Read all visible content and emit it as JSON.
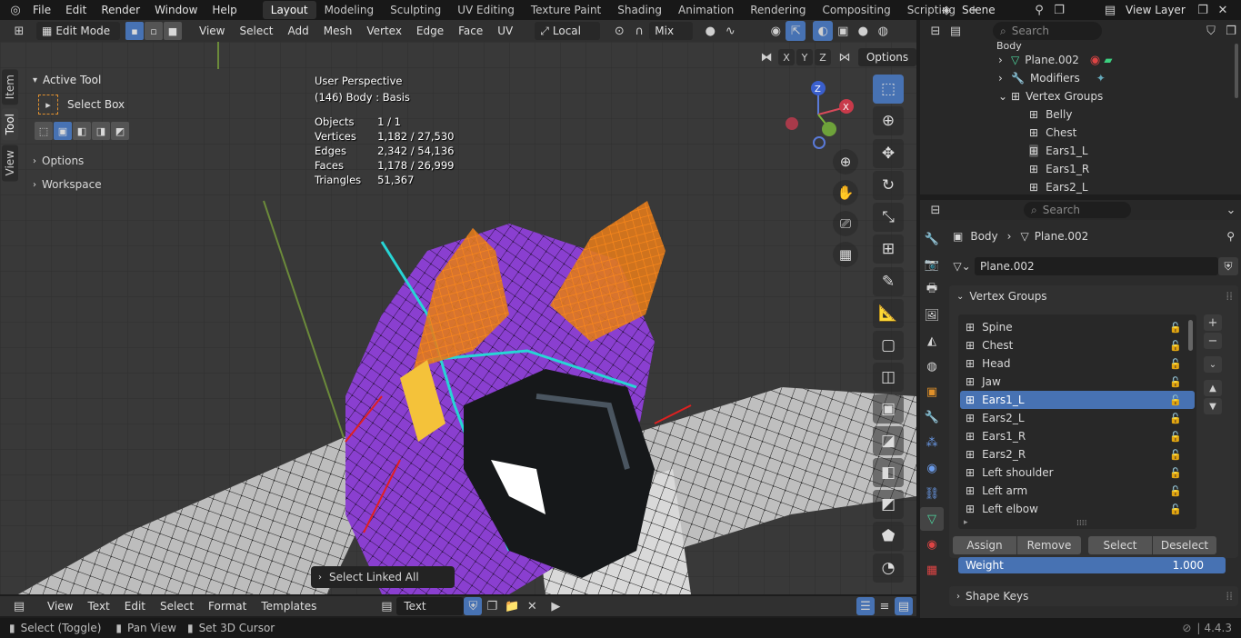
{
  "topbar": {
    "menus": [
      "File",
      "Edit",
      "Render",
      "Window",
      "Help"
    ],
    "workspaces": [
      "Layout",
      "Modeling",
      "Sculpting",
      "UV Editing",
      "Texture Paint",
      "Shading",
      "Animation",
      "Rendering",
      "Compositing",
      "Scripting"
    ],
    "active_workspace": "Layout",
    "scene": "Scene",
    "view_layer": "View Layer"
  },
  "viewport_header": {
    "mode": "Edit Mode",
    "menus": [
      "View",
      "Select",
      "Add",
      "Mesh",
      "Vertex",
      "Edge",
      "Face",
      "UV"
    ],
    "orientation": "Local",
    "snap": "Mix",
    "options": "Options",
    "axes": [
      "X",
      "Y",
      "Z"
    ]
  },
  "sidebar": {
    "tabs": [
      "Item",
      "Tool",
      "View"
    ],
    "active_tab": "Tool",
    "active_tool_title": "Active Tool",
    "active_tool": "Select Box",
    "options": "Options",
    "workspace": "Workspace"
  },
  "overlay": {
    "perspective": "User Perspective",
    "object": "(146) Body : Basis",
    "stats": [
      {
        "label": "Objects",
        "value": "1 / 1"
      },
      {
        "label": "Vertices",
        "value": "1,182 / 27,530"
      },
      {
        "label": "Edges",
        "value": "2,342 / 54,136"
      },
      {
        "label": "Faces",
        "value": "1,178 / 26,999"
      },
      {
        "label": "Triangles",
        "value": "51,367"
      }
    ],
    "last_op": "Select Linked All"
  },
  "outliner": {
    "search_placeholder": "Search",
    "items": [
      {
        "label": "Body",
        "indent": 0,
        "icon": "mesh-icon"
      },
      {
        "label": "Plane.002",
        "indent": 1,
        "icon": "mesh-data-icon"
      },
      {
        "label": "Modifiers",
        "indent": 1,
        "icon": "wrench-icon"
      },
      {
        "label": "Vertex Groups",
        "indent": 1,
        "icon": "vertex-group-icon"
      },
      {
        "label": "Belly",
        "indent": 2,
        "icon": "vertex-group-icon"
      },
      {
        "label": "Chest",
        "indent": 2,
        "icon": "vertex-group-icon"
      },
      {
        "label": "Ears1_L",
        "indent": 2,
        "icon": "vertex-group-icon"
      },
      {
        "label": "Ears1_R",
        "indent": 2,
        "icon": "vertex-group-icon"
      },
      {
        "label": "Ears2_L",
        "indent": 2,
        "icon": "vertex-group-icon"
      }
    ]
  },
  "properties": {
    "search_placeholder": "Search",
    "breadcrumb_object": "Body",
    "breadcrumb_data": "Plane.002",
    "data_name": "Plane.002",
    "vertex_groups_title": "Vertex Groups",
    "vertex_groups": [
      "Spine",
      "Chest",
      "Head",
      "Jaw",
      "Ears1_L",
      "Ears2_L",
      "Ears1_R",
      "Ears2_R",
      "Left shoulder",
      "Left arm",
      "Left elbow"
    ],
    "active_group": "Ears1_L",
    "buttons": [
      "Assign",
      "Remove",
      "Select",
      "Deselect"
    ],
    "weight_label": "Weight",
    "weight_value": "1.000",
    "weight_fraction": 1.0,
    "shape_keys_title": "Shape Keys"
  },
  "text_editor": {
    "menus": [
      "View",
      "Text",
      "Edit",
      "Select",
      "Format",
      "Templates"
    ],
    "text_name": "Text"
  },
  "status_bar": {
    "items": [
      "Select (Toggle)",
      "Pan View",
      "Set 3D Cursor"
    ],
    "version": "4.4.3"
  },
  "colors": {
    "accent": "#4772b3",
    "mesh_purple": "#8a3fd0",
    "selected_orange": "#ff8a1a",
    "seam_cyan": "#27d5d5"
  }
}
